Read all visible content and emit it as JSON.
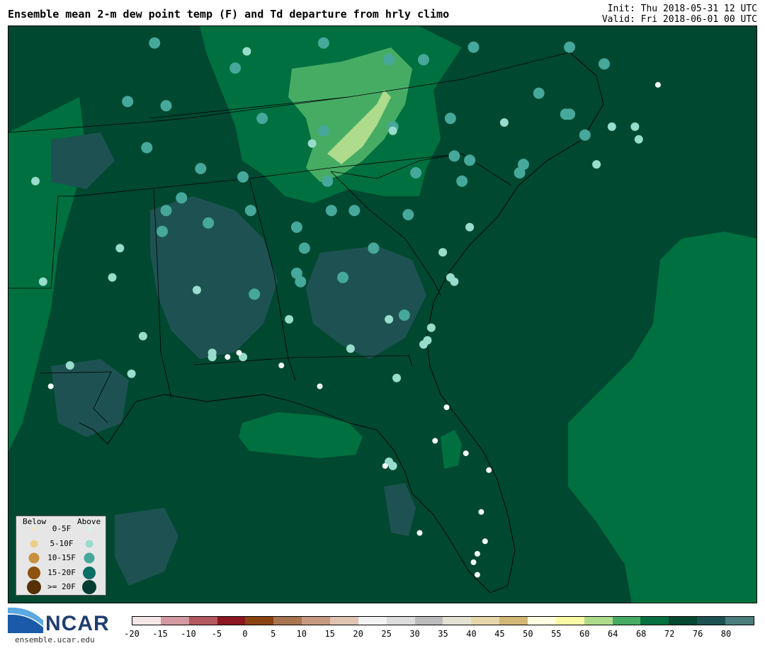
{
  "header": {
    "title": "Ensemble mean 2-m dew point temp (F) and Td departure from hrly climo",
    "init": "Init: Thu 2018-05-31 12 UTC",
    "valid": "Valid: Fri 2018-06-01 00 UTC"
  },
  "legend": {
    "below_label": "Below",
    "above_label": "Above",
    "rows": [
      {
        "label": "0-5F",
        "below_color": "#f3e6c8",
        "above_color": "#d6f2ec"
      },
      {
        "label": "5-10F",
        "below_color": "#eccf8a",
        "above_color": "#98dccb"
      },
      {
        "label": "10-15F",
        "below_color": "#c9913f",
        "above_color": "#45a89a"
      },
      {
        "label": "15-20F",
        "below_color": "#8e5212",
        "above_color": "#0a6e64"
      },
      {
        "label": ">= 20F",
        "below_color": "#553007",
        "above_color": "#033d32"
      }
    ]
  },
  "colorbar": {
    "colors": [
      "#f4e6e6",
      "#d29aa0",
      "#b25860",
      "#8c1622",
      "#8a4211",
      "#a87550",
      "#c59a80",
      "#dfc4b2",
      "#f2f2f2",
      "#dddddd",
      "#bcbcbc",
      "#e4e2d2",
      "#e6d6ac",
      "#d2b876",
      "#fefee0",
      "#fafaa6",
      "#aedc8c",
      "#46ac64",
      "#007040",
      "#004830",
      "#1e5252",
      "#4c7c7c"
    ],
    "tick_labels": [
      "-20",
      "-15",
      "-10",
      "-5",
      "0",
      "5",
      "10",
      "15",
      "20",
      "25",
      "30",
      "35",
      "40",
      "45",
      "50",
      "55",
      "60",
      "64",
      "68",
      "72",
      "76",
      "80"
    ]
  },
  "branding": {
    "logo_text": "NCAR",
    "url": "ensemble.ucar.edu"
  },
  "map": {
    "base_color": "#004830",
    "moist_color": "#007040",
    "light_color": "#46ac64",
    "lighter_color": "#aedc8c",
    "dark_patch_color": "#1e5252"
  },
  "stations": [
    {
      "lon": -88.7,
      "lat": 37.9,
      "cat": 2
    },
    {
      "lon": -86.3,
      "lat": 37.7,
      "cat": 1
    },
    {
      "lon": -84.3,
      "lat": 37.9,
      "cat": 2
    },
    {
      "lon": -81.7,
      "lat": 37.5,
      "cat": 2
    },
    {
      "lon": -80.4,
      "lat": 37.8,
      "cat": 2
    },
    {
      "lon": -77.9,
      "lat": 37.8,
      "cat": 2
    },
    {
      "lon": -77.0,
      "lat": 37.4,
      "cat": 2
    },
    {
      "lon": -82.6,
      "lat": 37.5,
      "cat": 2
    },
    {
      "lon": -86.6,
      "lat": 37.3,
      "cat": 2
    },
    {
      "lon": -89.4,
      "lat": 36.5,
      "cat": 2
    },
    {
      "lon": -88.4,
      "lat": 36.4,
      "cat": 2
    },
    {
      "lon": -85.9,
      "lat": 36.1,
      "cat": 2
    },
    {
      "lon": -84.3,
      "lat": 35.8,
      "cat": 2
    },
    {
      "lon": -82.5,
      "lat": 35.9,
      "cat": 2
    },
    {
      "lon": -81.0,
      "lat": 36.1,
      "cat": 2
    },
    {
      "lon": -78.7,
      "lat": 36.7,
      "cat": 2
    },
    {
      "lon": -79.6,
      "lat": 36.0,
      "cat": 1
    },
    {
      "lon": -78.0,
      "lat": 36.2,
      "cat": 2
    },
    {
      "lon": -77.9,
      "lat": 36.2,
      "cat": 2
    },
    {
      "lon": -77.5,
      "lat": 35.7,
      "cat": 2
    },
    {
      "lon": -76.8,
      "lat": 35.9,
      "cat": 1
    },
    {
      "lon": -76.2,
      "lat": 35.9,
      "cat": 1
    },
    {
      "lon": -76.1,
      "lat": 35.6,
      "cat": 1
    },
    {
      "lon": -75.6,
      "lat": 36.9,
      "cat": 0
    },
    {
      "lon": -84.6,
      "lat": 35.5,
      "cat": 1
    },
    {
      "lon": -82.5,
      "lat": 35.8,
      "cat": 1
    },
    {
      "lon": -80.5,
      "lat": 35.1,
      "cat": 2
    },
    {
      "lon": -80.9,
      "lat": 35.2,
      "cat": 2
    },
    {
      "lon": -79.1,
      "lat": 35.0,
      "cat": 2
    },
    {
      "lon": -77.2,
      "lat": 35.0,
      "cat": 1
    },
    {
      "lon": -88.9,
      "lat": 35.4,
      "cat": 2
    },
    {
      "lon": -87.5,
      "lat": 34.9,
      "cat": 2
    },
    {
      "lon": -86.4,
      "lat": 34.7,
      "cat": 2
    },
    {
      "lon": -84.2,
      "lat": 34.6,
      "cat": 2
    },
    {
      "lon": -81.9,
      "lat": 34.8,
      "cat": 2
    },
    {
      "lon": -80.7,
      "lat": 34.6,
      "cat": 2
    },
    {
      "lon": -79.2,
      "lat": 34.8,
      "cat": 2
    },
    {
      "lon": -91.8,
      "lat": 34.6,
      "cat": 1
    },
    {
      "lon": -88.0,
      "lat": 34.2,
      "cat": 2
    },
    {
      "lon": -86.2,
      "lat": 33.9,
      "cat": 2
    },
    {
      "lon": -82.1,
      "lat": 33.8,
      "cat": 2
    },
    {
      "lon": -80.5,
      "lat": 33.5,
      "cat": 1
    },
    {
      "lon": -83.5,
      "lat": 33.9,
      "cat": 2
    },
    {
      "lon": -84.1,
      "lat": 33.9,
      "cat": 2
    },
    {
      "lon": -85.0,
      "lat": 33.5,
      "cat": 2
    },
    {
      "lon": -87.3,
      "lat": 33.6,
      "cat": 2
    },
    {
      "lon": -88.4,
      "lat": 33.9,
      "cat": 2
    },
    {
      "lon": -89.6,
      "lat": 33.0,
      "cat": 1
    },
    {
      "lon": -88.5,
      "lat": 33.4,
      "cat": 2
    },
    {
      "lon": -81.2,
      "lat": 32.9,
      "cat": 1
    },
    {
      "lon": -83.0,
      "lat": 33.0,
      "cat": 2
    },
    {
      "lon": -84.8,
      "lat": 33.0,
      "cat": 2
    },
    {
      "lon": -81.0,
      "lat": 32.3,
      "cat": 1
    },
    {
      "lon": -80.9,
      "lat": 32.2,
      "cat": 1
    },
    {
      "lon": -83.8,
      "lat": 32.3,
      "cat": 2
    },
    {
      "lon": -84.9,
      "lat": 32.2,
      "cat": 2
    },
    {
      "lon": -85.0,
      "lat": 32.4,
      "cat": 2
    },
    {
      "lon": -86.1,
      "lat": 31.9,
      "cat": 2
    },
    {
      "lon": -89.8,
      "lat": 32.3,
      "cat": 1
    },
    {
      "lon": -91.6,
      "lat": 32.2,
      "cat": 1
    },
    {
      "lon": -87.6,
      "lat": 32.0,
      "cat": 1
    },
    {
      "lon": -82.2,
      "lat": 31.4,
      "cat": 2
    },
    {
      "lon": -85.2,
      "lat": 31.3,
      "cat": 1
    },
    {
      "lon": -82.6,
      "lat": 31.3,
      "cat": 1
    },
    {
      "lon": -81.5,
      "lat": 31.1,
      "cat": 1
    },
    {
      "lon": -81.7,
      "lat": 30.7,
      "cat": 1
    },
    {
      "lon": -81.6,
      "lat": 30.8,
      "cat": 1
    },
    {
      "lon": -83.6,
      "lat": 30.6,
      "cat": 1
    },
    {
      "lon": -89.0,
      "lat": 30.9,
      "cat": 1
    },
    {
      "lon": -86.4,
      "lat": 30.4,
      "cat": 1
    },
    {
      "lon": -87.2,
      "lat": 30.5,
      "cat": 1
    },
    {
      "lon": -87.2,
      "lat": 30.4,
      "cat": 1
    },
    {
      "lon": -90.9,
      "lat": 30.2,
      "cat": 1
    },
    {
      "lon": -89.3,
      "lat": 30.0,
      "cat": 1
    },
    {
      "lon": -82.4,
      "lat": 29.9,
      "cat": 1
    },
    {
      "lon": -91.4,
      "lat": 29.7,
      "cat": 0
    },
    {
      "lon": -84.4,
      "lat": 29.7,
      "cat": 0
    },
    {
      "lon": -86.8,
      "lat": 30.4,
      "cat": 0
    },
    {
      "lon": -86.5,
      "lat": 30.5,
      "cat": 0
    },
    {
      "lon": -85.4,
      "lat": 30.2,
      "cat": 0
    },
    {
      "lon": -81.1,
      "lat": 29.2,
      "cat": 0
    },
    {
      "lon": -80.6,
      "lat": 28.1,
      "cat": 0
    },
    {
      "lon": -81.4,
      "lat": 28.4,
      "cat": 0
    },
    {
      "lon": -80.0,
      "lat": 27.7,
      "cat": 0
    },
    {
      "lon": -80.2,
      "lat": 26.7,
      "cat": 0
    },
    {
      "lon": -81.8,
      "lat": 26.2,
      "cat": 0
    },
    {
      "lon": -80.1,
      "lat": 26.0,
      "cat": 0
    },
    {
      "lon": -80.3,
      "lat": 25.7,
      "cat": 0
    },
    {
      "lon": -80.4,
      "lat": 25.5,
      "cat": 0
    },
    {
      "lon": -80.3,
      "lat": 25.2,
      "cat": 0
    },
    {
      "lon": -82.6,
      "lat": 27.9,
      "cat": 1
    },
    {
      "lon": -82.5,
      "lat": 27.8,
      "cat": 1
    },
    {
      "lon": -82.7,
      "lat": 27.8,
      "cat": 0
    }
  ]
}
